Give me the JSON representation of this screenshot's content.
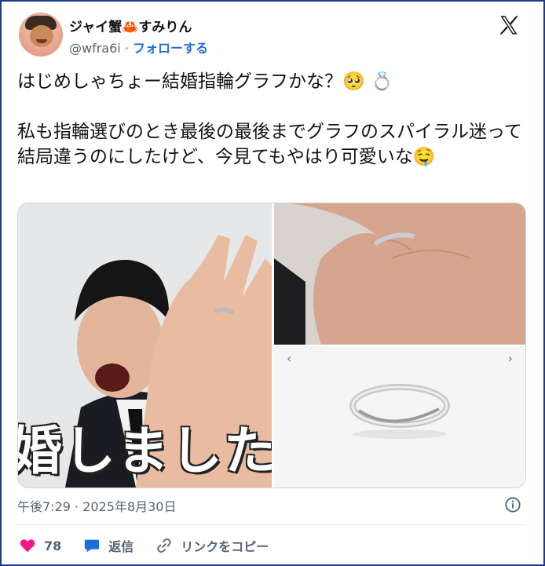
{
  "header": {
    "name": "ジャイ蟹🦀すみりん",
    "handle": "@wfra6i",
    "separator": " · ",
    "follow_label": "フォローする"
  },
  "tweet": {
    "line1": "はじめしゃちょー結婚指輪グラフかな？🥺 💍",
    "line2": "私も指輪選びのとき最後の最後までグラフのスパイラル迷って結局違うのにしたけど、今見てもやはり可愛いな🤤"
  },
  "media": {
    "caption_overlay": "婚しました",
    "prev_glyph": "‹",
    "next_glyph": "›"
  },
  "meta": {
    "time": "午後7:29",
    "separator": " · ",
    "date": "2025年8月30日"
  },
  "actions": {
    "like_count": "78",
    "reply_label": "返信",
    "copy_link_label": "リンクをコピー"
  },
  "colors": {
    "accent": "#1d6fd8",
    "like": "#f91880",
    "frame": "#1d3a8a",
    "muted": "#536471"
  },
  "icons": [
    "x-logo-icon",
    "heart-icon",
    "reply-bubble-icon",
    "link-icon",
    "info-icon",
    "chevron-left-icon",
    "chevron-right-icon"
  ]
}
